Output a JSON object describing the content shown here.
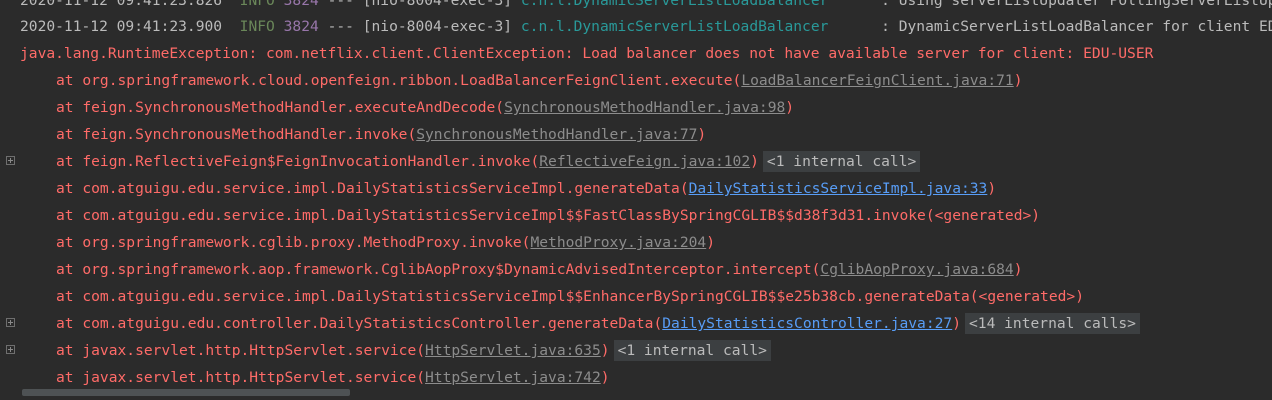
{
  "header_line": {
    "timestamp1": "2020-11-12 09:41:23.826",
    "level1": "INFO",
    "pid1": "3824",
    "thread1": "--- [nio-8004-exec-3]",
    "logger1": "c.n.l.DynamicServerListLoadBalancer",
    "message1": ": Using serverListUpdater PollingServerListUpdater",
    "timestamp2": "2020-11-12 09:41:23.900",
    "level2": "INFO",
    "pid2": "3824",
    "thread2": "--- [nio-8004-exec-3]",
    "logger2": "c.n.l.DynamicServerListLoadBalancer",
    "message2": ": DynamicServerListLoadBalancer for client EDU-USER"
  },
  "exception": "java.lang.RuntimeException: com.netflix.client.ClientException: Load balancer does not have available server for client: EDU-USER",
  "stack": [
    {
      "text": "at org.springframework.cloud.openfeign.ribbon.LoadBalancerFeignClient.execute(",
      "link": "LoadBalancerFeignClient.java:71",
      "link_color": "gray",
      "tail": ")",
      "fold": ""
    },
    {
      "text": "at feign.SynchronousMethodHandler.executeAndDecode(",
      "link": "SynchronousMethodHandler.java:98",
      "link_color": "gray",
      "tail": ")",
      "fold": ""
    },
    {
      "text": "at feign.SynchronousMethodHandler.invoke(",
      "link": "SynchronousMethodHandler.java:77",
      "link_color": "gray",
      "tail": ")",
      "fold": ""
    },
    {
      "text": "at feign.ReflectiveFeign$FeignInvocationHandler.invoke(",
      "link": "ReflectiveFeign.java:102",
      "link_color": "gray",
      "tail": ")",
      "fold": "<1 internal call>"
    },
    {
      "text": "at com.atguigu.edu.service.impl.DailyStatisticsServiceImpl.generateData(",
      "link": "DailyStatisticsServiceImpl.java:33",
      "link_color": "blue",
      "tail": ")",
      "fold": ""
    },
    {
      "text": "at com.atguigu.edu.service.impl.DailyStatisticsServiceImpl$$FastClassBySpringCGLIB$$d38f3d31.invoke(<generated>)",
      "link": "",
      "link_color": "",
      "tail": "",
      "fold": ""
    },
    {
      "text": "at org.springframework.cglib.proxy.MethodProxy.invoke(",
      "link": "MethodProxy.java:204",
      "link_color": "gray",
      "tail": ")",
      "fold": ""
    },
    {
      "text": "at org.springframework.aop.framework.CglibAopProxy$DynamicAdvisedInterceptor.intercept(",
      "link": "CglibAopProxy.java:684",
      "link_color": "gray",
      "tail": ")",
      "fold": ""
    },
    {
      "text": "at com.atguigu.edu.service.impl.DailyStatisticsServiceImpl$$EnhancerBySpringCGLIB$$e25b38cb.generateData(<generated>)",
      "link": "",
      "link_color": "",
      "tail": "",
      "fold": ""
    },
    {
      "text": "at com.atguigu.edu.controller.DailyStatisticsController.generateData(",
      "link": "DailyStatisticsController.java:27",
      "link_color": "blue",
      "tail": ")",
      "fold": "<14 internal calls>"
    },
    {
      "text": "at javax.servlet.http.HttpServlet.service(",
      "link": "HttpServlet.java:635",
      "link_color": "gray",
      "tail": ")",
      "fold": "<1 internal call>"
    },
    {
      "text": "at javax.servlet.http.HttpServlet.service(",
      "link": "HttpServlet.java:742",
      "link_color": "gray",
      "tail": ")",
      "fold": ""
    }
  ]
}
